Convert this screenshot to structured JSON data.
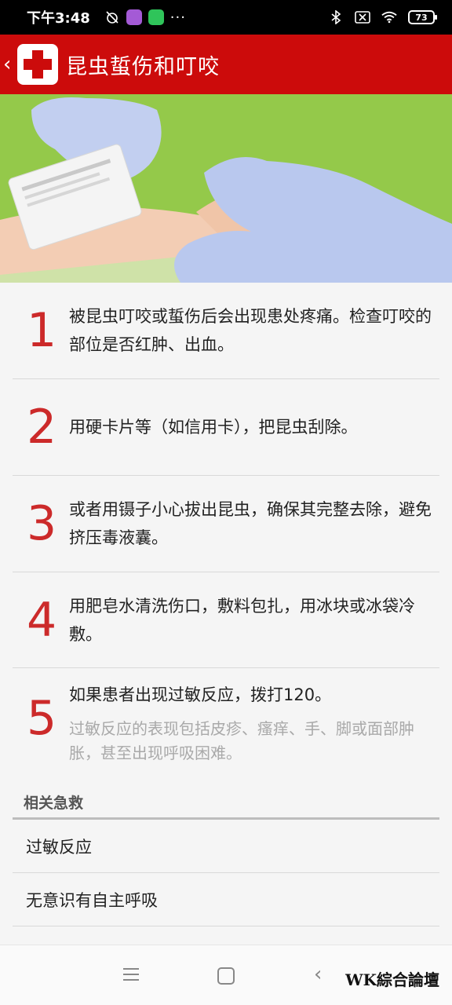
{
  "status_bar": {
    "time": "下午3:48",
    "battery": "73"
  },
  "header": {
    "back_glyph": "‹",
    "title": "昆虫蜇伤和叮咬"
  },
  "steps": [
    {
      "num": "1",
      "text": "被昆虫叮咬或蜇伤后会出现患处疼痛。检查叮咬的部位是否红肿、出血。"
    },
    {
      "num": "2",
      "text": "用硬卡片等（如信用卡），把昆虫刮除。"
    },
    {
      "num": "3",
      "text": "或者用镊子小心拔出昆虫，确保其完整去除，避免挤压毒液囊。"
    },
    {
      "num": "4",
      "text": "用肥皂水清洗伤口，敷料包扎，用冰块或冰袋冷敷。"
    },
    {
      "num": "5",
      "text": "如果患者出现过敏反应，拨打120。",
      "sub": "过敏反应的表现包括皮疹、瘙痒、手、脚或面部肿胀，甚至出现呼吸困难。"
    }
  ],
  "related": {
    "title": "相关急救",
    "items": [
      "过敏反应",
      "无意识有自主呼吸"
    ]
  },
  "watermark": "WK綜合論壇",
  "colors": {
    "header_red": "#cc0b0b",
    "step_number_red": "#cc2a2a"
  }
}
